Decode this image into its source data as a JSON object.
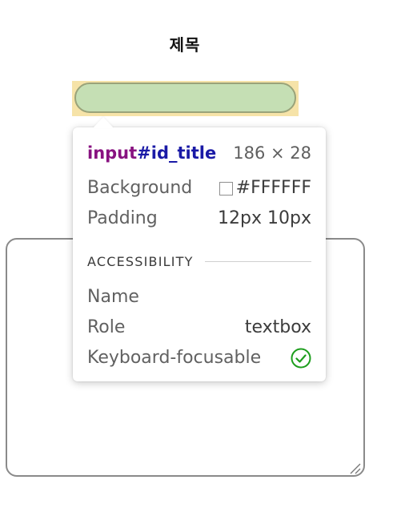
{
  "page": {
    "title": "제목"
  },
  "inspector": {
    "selector_tag": "input",
    "selector_id": "#id_title",
    "dimensions": "186 × 28",
    "background_label": "Background",
    "background_value": "#FFFFFF",
    "padding_label": "Padding",
    "padding_value": "12px 10px",
    "accessibility_header": "ACCESSIBILITY",
    "name_label": "Name",
    "name_value": "",
    "role_label": "Role",
    "role_value": "textbox",
    "keyboard_label": "Keyboard-focusable",
    "keyboard_icon": "check-circle-icon"
  },
  "colors": {
    "input_highlight_fill": "#C5DFB4",
    "input_highlight_margin": "#F6E3A8",
    "selector_tag": "#881280",
    "selector_id": "#1A1AA6",
    "check": "#1E9E1E"
  }
}
